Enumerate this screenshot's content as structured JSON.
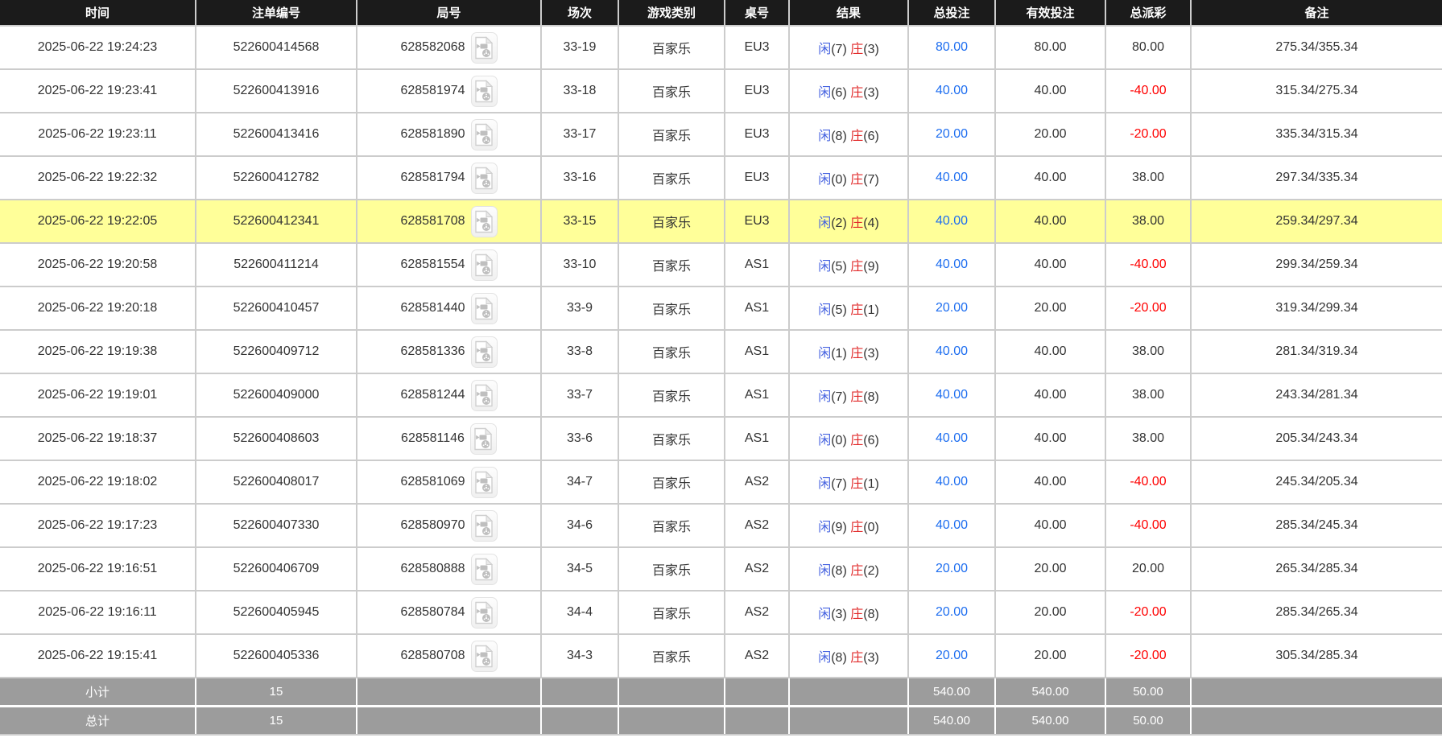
{
  "table": {
    "columns": [
      {
        "key": "time",
        "label": "时间"
      },
      {
        "key": "bet_no",
        "label": "注单编号"
      },
      {
        "key": "round_no",
        "label": "局号"
      },
      {
        "key": "session",
        "label": "场次"
      },
      {
        "key": "game",
        "label": "游戏类别"
      },
      {
        "key": "table_no",
        "label": "桌号"
      },
      {
        "key": "result",
        "label": "结果"
      },
      {
        "key": "total_bet",
        "label": "总投注"
      },
      {
        "key": "valid_bet",
        "label": "有效投注"
      },
      {
        "key": "payout",
        "label": "总派彩"
      },
      {
        "key": "remark",
        "label": "备注"
      }
    ],
    "result_labels": {
      "player": "闲",
      "banker": "庄"
    },
    "icons": {
      "round_media": "video-file-icon"
    },
    "rows": [
      {
        "time": "2025-06-22 19:24:23",
        "bet_no": "522600414568",
        "round_no": "628582068",
        "session": "33-19",
        "game": "百家乐",
        "table_no": "EU3",
        "player_score": "(7)",
        "banker_score": "(3)",
        "total_bet": "80.00",
        "valid_bet": "80.00",
        "payout": "80.00",
        "remark": "275.34/355.34",
        "highlighted": false
      },
      {
        "time": "2025-06-22 19:23:41",
        "bet_no": "522600413916",
        "round_no": "628581974",
        "session": "33-18",
        "game": "百家乐",
        "table_no": "EU3",
        "player_score": "(6)",
        "banker_score": "(3)",
        "total_bet": "40.00",
        "valid_bet": "40.00",
        "payout": "-40.00",
        "remark": "315.34/275.34",
        "highlighted": false
      },
      {
        "time": "2025-06-22 19:23:11",
        "bet_no": "522600413416",
        "round_no": "628581890",
        "session": "33-17",
        "game": "百家乐",
        "table_no": "EU3",
        "player_score": "(8)",
        "banker_score": "(6)",
        "total_bet": "20.00",
        "valid_bet": "20.00",
        "payout": "-20.00",
        "remark": "335.34/315.34",
        "highlighted": false
      },
      {
        "time": "2025-06-22 19:22:32",
        "bet_no": "522600412782",
        "round_no": "628581794",
        "session": "33-16",
        "game": "百家乐",
        "table_no": "EU3",
        "player_score": "(0)",
        "banker_score": "(7)",
        "total_bet": "40.00",
        "valid_bet": "40.00",
        "payout": "38.00",
        "remark": "297.34/335.34",
        "highlighted": false
      },
      {
        "time": "2025-06-22 19:22:05",
        "bet_no": "522600412341",
        "round_no": "628581708",
        "session": "33-15",
        "game": "百家乐",
        "table_no": "EU3",
        "player_score": "(2)",
        "banker_score": "(4)",
        "total_bet": "40.00",
        "valid_bet": "40.00",
        "payout": "38.00",
        "remark": "259.34/297.34",
        "highlighted": true
      },
      {
        "time": "2025-06-22 19:20:58",
        "bet_no": "522600411214",
        "round_no": "628581554",
        "session": "33-10",
        "game": "百家乐",
        "table_no": "AS1",
        "player_score": "(5)",
        "banker_score": "(9)",
        "total_bet": "40.00",
        "valid_bet": "40.00",
        "payout": "-40.00",
        "remark": "299.34/259.34",
        "highlighted": false
      },
      {
        "time": "2025-06-22 19:20:18",
        "bet_no": "522600410457",
        "round_no": "628581440",
        "session": "33-9",
        "game": "百家乐",
        "table_no": "AS1",
        "player_score": "(5)",
        "banker_score": "(1)",
        "total_bet": "20.00",
        "valid_bet": "20.00",
        "payout": "-20.00",
        "remark": "319.34/299.34",
        "highlighted": false
      },
      {
        "time": "2025-06-22 19:19:38",
        "bet_no": "522600409712",
        "round_no": "628581336",
        "session": "33-8",
        "game": "百家乐",
        "table_no": "AS1",
        "player_score": "(1)",
        "banker_score": "(3)",
        "total_bet": "40.00",
        "valid_bet": "40.00",
        "payout": "38.00",
        "remark": "281.34/319.34",
        "highlighted": false
      },
      {
        "time": "2025-06-22 19:19:01",
        "bet_no": "522600409000",
        "round_no": "628581244",
        "session": "33-7",
        "game": "百家乐",
        "table_no": "AS1",
        "player_score": "(7)",
        "banker_score": "(8)",
        "total_bet": "40.00",
        "valid_bet": "40.00",
        "payout": "38.00",
        "remark": "243.34/281.34",
        "highlighted": false
      },
      {
        "time": "2025-06-22 19:18:37",
        "bet_no": "522600408603",
        "round_no": "628581146",
        "session": "33-6",
        "game": "百家乐",
        "table_no": "AS1",
        "player_score": "(0)",
        "banker_score": "(6)",
        "total_bet": "40.00",
        "valid_bet": "40.00",
        "payout": "38.00",
        "remark": "205.34/243.34",
        "highlighted": false
      },
      {
        "time": "2025-06-22 19:18:02",
        "bet_no": "522600408017",
        "round_no": "628581069",
        "session": "34-7",
        "game": "百家乐",
        "table_no": "AS2",
        "player_score": "(7)",
        "banker_score": "(1)",
        "total_bet": "40.00",
        "valid_bet": "40.00",
        "payout": "-40.00",
        "remark": "245.34/205.34",
        "highlighted": false
      },
      {
        "time": "2025-06-22 19:17:23",
        "bet_no": "522600407330",
        "round_no": "628580970",
        "session": "34-6",
        "game": "百家乐",
        "table_no": "AS2",
        "player_score": "(9)",
        "banker_score": "(0)",
        "total_bet": "40.00",
        "valid_bet": "40.00",
        "payout": "-40.00",
        "remark": "285.34/245.34",
        "highlighted": false
      },
      {
        "time": "2025-06-22 19:16:51",
        "bet_no": "522600406709",
        "round_no": "628580888",
        "session": "34-5",
        "game": "百家乐",
        "table_no": "AS2",
        "player_score": "(8)",
        "banker_score": "(2)",
        "total_bet": "20.00",
        "valid_bet": "20.00",
        "payout": "20.00",
        "remark": "265.34/285.34",
        "highlighted": false
      },
      {
        "time": "2025-06-22 19:16:11",
        "bet_no": "522600405945",
        "round_no": "628580784",
        "session": "34-4",
        "game": "百家乐",
        "table_no": "AS2",
        "player_score": "(3)",
        "banker_score": "(8)",
        "total_bet": "20.00",
        "valid_bet": "20.00",
        "payout": "-20.00",
        "remark": "285.34/265.34",
        "highlighted": false
      },
      {
        "time": "2025-06-22 19:15:41",
        "bet_no": "522600405336",
        "round_no": "628580708",
        "session": "34-3",
        "game": "百家乐",
        "table_no": "AS2",
        "player_score": "(8)",
        "banker_score": "(3)",
        "total_bet": "20.00",
        "valid_bet": "20.00",
        "payout": "-20.00",
        "remark": "305.34/285.34",
        "highlighted": false
      }
    ],
    "footer": [
      {
        "label": "小计",
        "count": "15",
        "total_bet": "540.00",
        "valid_bet": "540.00",
        "payout": "50.00"
      },
      {
        "label": "总计",
        "count": "15",
        "total_bet": "540.00",
        "valid_bet": "540.00",
        "payout": "50.00"
      }
    ]
  },
  "colors": {
    "header_bg": "#1b1b1b",
    "header_text": "#ffffff",
    "cell_border": "#cccccc",
    "text": "#333333",
    "highlight_row_bg": "#ffff99",
    "footer_bg": "#9c9c9c",
    "footer_text": "#ffffff",
    "player_blue": "#4663e0",
    "banker_red": "#e12b2b",
    "total_bet_blue": "#1e6ef0",
    "negative_red": "#ff0000"
  }
}
